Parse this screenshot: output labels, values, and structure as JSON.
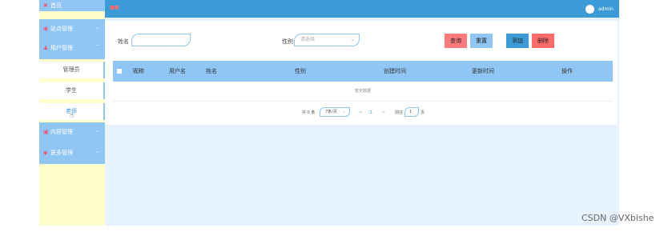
{
  "sidebar": {
    "home": {
      "label": "首页"
    },
    "menus": [
      {
        "label": "站点管理"
      },
      {
        "label": "用户管理"
      },
      {
        "label": "内容管理"
      },
      {
        "label": "更多管理"
      }
    ],
    "user_sub": [
      {
        "label": "管理员"
      },
      {
        "label": "学生"
      },
      {
        "label": "老师"
      }
    ]
  },
  "topbar": {
    "brand": "■■",
    "username": "admin"
  },
  "search": {
    "name_label": "姓名",
    "name_value": "",
    "gender_label": "性别",
    "gender_placeholder": "请选择"
  },
  "buttons": {
    "query": "查询",
    "reset": "重置",
    "add": "添加",
    "delete": "删除"
  },
  "table": {
    "headers": [
      "昵称",
      "用户名",
      "姓名",
      "性别",
      "创建时间",
      "更新时间",
      "操作"
    ],
    "empty_text": "暂无数据"
  },
  "pagination": {
    "total_text": "共 0 条",
    "page_size": "7条/页",
    "prev": "<",
    "current_page": "1",
    "next": ">",
    "goto_label": "前往",
    "goto_value": "1",
    "goto_suffix": "页"
  },
  "watermark": "CSDN @VXbishe",
  "colors": {
    "sidebar_menu": "#8fc6f4",
    "topbar": "#3c9ad6",
    "query": "#ff7a7a",
    "reset": "#8fc6f4",
    "add": "#3c9ad6",
    "delete": "#ff6b6b"
  }
}
